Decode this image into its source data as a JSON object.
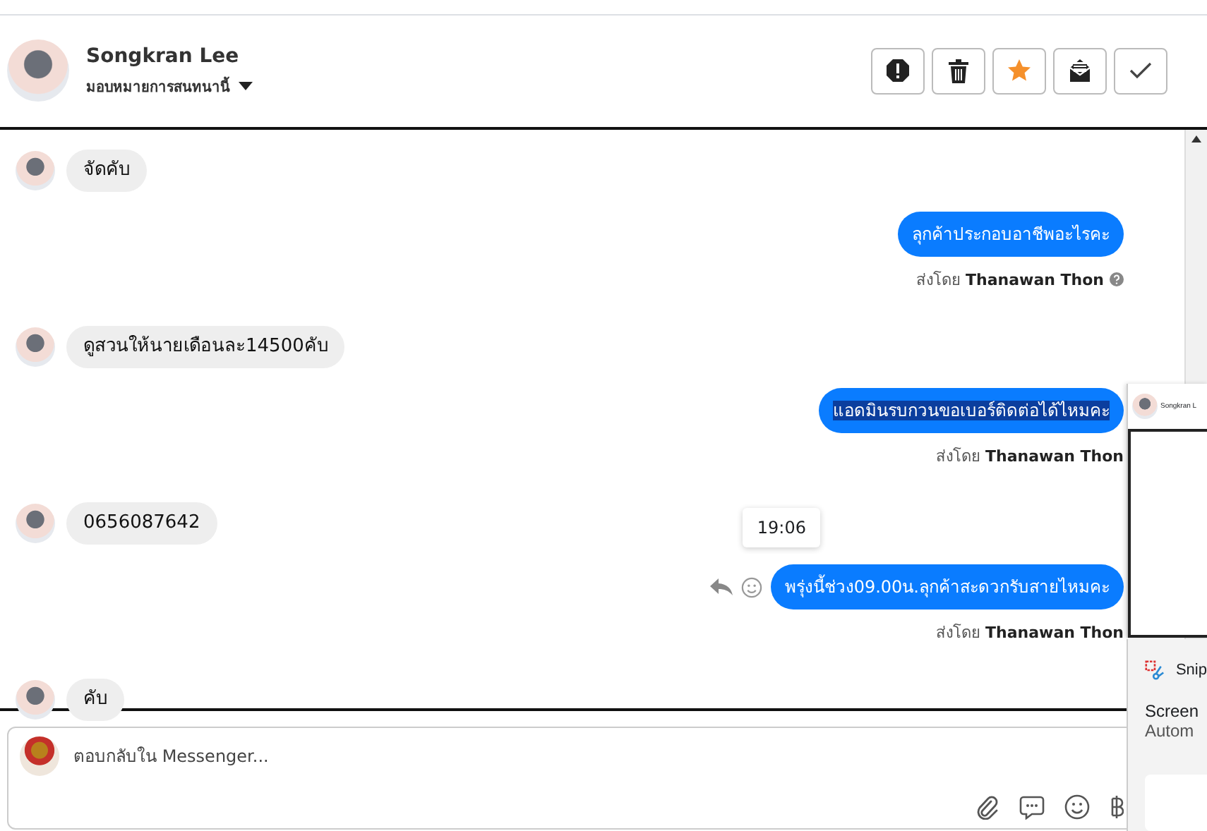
{
  "header": {
    "name": "Songkran Lee",
    "assign_label": "มอบหมายการสนทนานี้",
    "starred": true,
    "actions": [
      {
        "kind": "report"
      },
      {
        "kind": "delete"
      },
      {
        "kind": "star"
      },
      {
        "kind": "mail"
      },
      {
        "kind": "done"
      }
    ]
  },
  "messages": [
    {
      "kind": "incoming",
      "text": "จัดคับ"
    },
    {
      "kind": "outgoing",
      "text": "ลุกค้าประกอบอาชีพอะไรคะ",
      "sent_by_label": "ส่งโดย",
      "sender": "Thanawan Thon",
      "help": true,
      "highlighted": false
    },
    {
      "kind": "incoming",
      "text": "ดูสวนให้นายเดือนละ14500คับ"
    },
    {
      "kind": "outgoing",
      "text": "แอดมินรบกวนขอเบอร์ติดต่อได้ไหมคะ",
      "sent_by_label": "ส่งโดย",
      "sender": "Thanawan Thon",
      "help": false,
      "highlighted": true
    },
    {
      "kind": "incoming",
      "text": "0656087642"
    },
    {
      "kind": "outgoing",
      "text": "พรุ่งนี้ช่วง09.00น.ลุกค้าสะดวกรับสายไหมคะ",
      "sent_by_label": "ส่งโดย",
      "sender": "Thanawan Thon",
      "help": false,
      "highlighted": false,
      "hover_actions": true,
      "time_tooltip": "19:06"
    },
    {
      "kind": "incoming",
      "text": "คับ"
    }
  ],
  "composer": {
    "placeholder": "ตอบกลับใน Messenger..."
  },
  "preview_popup": {
    "name": "Songkran L"
  },
  "notification": {
    "app": "Snip",
    "title": "Screen",
    "subtitle": "Autom"
  }
}
